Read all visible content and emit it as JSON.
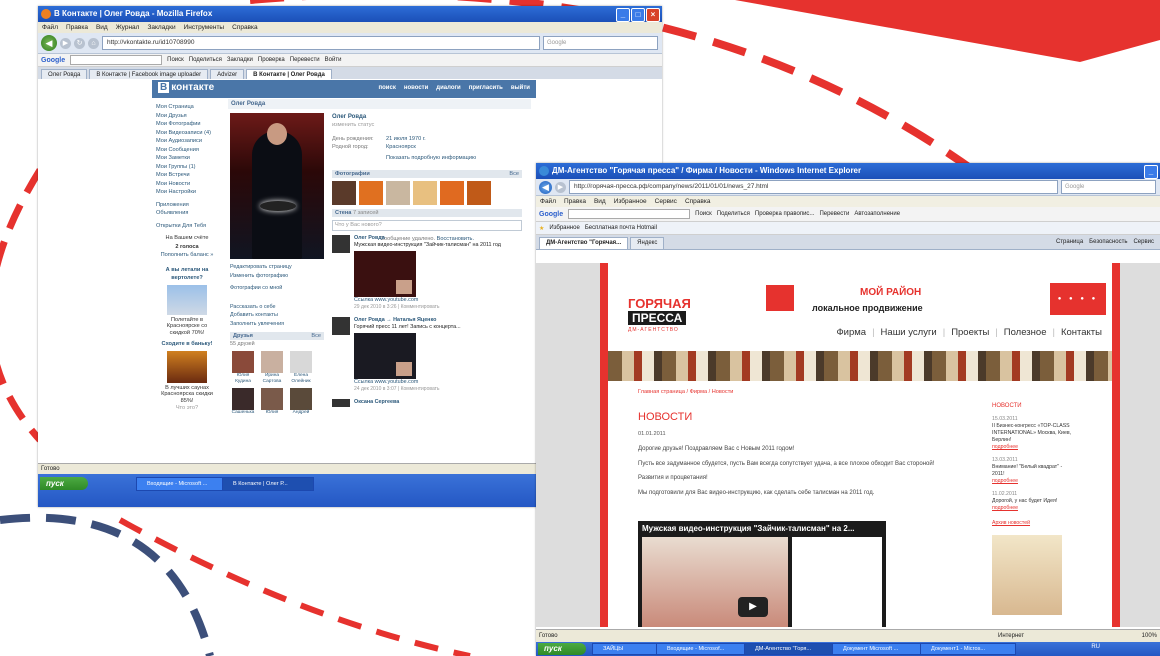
{
  "colors": {
    "accent_red": "#e6322e",
    "dash_blue": "#3c4f7a",
    "vk_blue": "#4a76a8"
  },
  "firefox": {
    "title": "В Контакте | Олег Ровда - Mozilla Firefox",
    "menu": [
      "Файл",
      "Правка",
      "Вид",
      "Журнал",
      "Закладки",
      "Инструменты",
      "Справка"
    ],
    "url": "http://vkontakte.ru/id10708990",
    "search_placeholder": "Google",
    "google_label": "Google",
    "toolbar_items": [
      "Поиск",
      "Поделиться",
      "Закладки",
      "Проверка",
      "Перевести",
      "Войти"
    ],
    "tabs": [
      "Олег Ровда",
      "В Контакте | Facebook image uploader",
      "Advizer",
      "В Контакте | Олег Ровда"
    ],
    "status": "Готово"
  },
  "vk": {
    "logo": "контакте",
    "nav": [
      "поиск",
      "новости",
      "диалоги",
      "пригласить",
      "выйти"
    ],
    "menu": [
      "Моя Страница",
      "Мои Друзья",
      "Мои Фотографии",
      "Мои Видеозаписи (4)",
      "Мои Аудиозаписи",
      "Мои Сообщения",
      "Мои Заметки",
      "Мои Группы (1)",
      "Мои Встречи",
      "Мои Новости",
      "Мои Настройки",
      "Приложения",
      "Объявления",
      "Открытки Для Тебя"
    ],
    "balance_label": "На Вашем счёте",
    "balance_value": "2 голоса",
    "balance_link": "Пополнить баланс »",
    "ad1_title": "А вы летали на вертолете?",
    "ad1_text": "Полетайте в Красноярске со скидкой 70%!",
    "ad2_title": "Сходите в баньку!",
    "ad2_text": "В лучших саунах Красноярска скидки 85%!",
    "ad_more": "Что это?",
    "name_header": "Олег Ровда",
    "profile_name": "Олег Ровда",
    "status_line": "изменить статус",
    "birthday_label": "День рождения:",
    "birthday_value": "21 июля 1970 г.",
    "hometown_label": "Родной город:",
    "hometown_value": "Красноярск",
    "more_info": "Показать подробную информацию",
    "photos_header": "Фотографии",
    "photos_all": "Все",
    "wall_header": "Стена",
    "wall_count": "7 записей",
    "wall_input_placeholder": "Что у Вас нового?",
    "wall_deleted": "Сообщение удалено.",
    "wall_restore": "Восстановить.",
    "edit_page": "Редактировать страницу",
    "change_photo": "Изменить фотографию",
    "photos_with_me": "Фотографии со мной",
    "tell_friends": "Рассказать о себе",
    "add_contacts": "Добавить контакты",
    "fill_interests": "Заполнить увлечения",
    "friends_header": "Друзья",
    "friends_count": "55 друзей",
    "friends_all": "Все",
    "friends": [
      "Юлия Кудина",
      "Ирина Сартова",
      "Елена Олейник",
      "Сашенька",
      "Юлия",
      "Андрей"
    ],
    "posts": [
      {
        "author": "Олег Ровда",
        "text": "Мужская видео-инструкция \"Зайчик-талисман\" на 2011 год",
        "link": "Ссылка www.youtube.com",
        "meta": "29 дек 2010 в 3:26 | Комментировать"
      },
      {
        "author": "Олег Ровда → Наталья Яценко",
        "text": "Горячий пресс 11 лет! Запись с концерта...",
        "link": "Ссылка www.youtube.com",
        "meta": "24 дек 2010 в 3:07 | Комментировать"
      },
      {
        "author": "Оксана Сергеева",
        "text": "",
        "link": "",
        "meta": ""
      }
    ]
  },
  "firefox_taskbar": {
    "start": "пуск",
    "items": [
      "Входящие - Microsoft ...",
      "В Контакте | Олег Р..."
    ]
  },
  "ie": {
    "title": "ДМ-Агентство \"Горячая пресса\" / Фирма / Новости - Windows Internet Explorer",
    "url": "http://горячая-пресса.рф/company/news/2011/01/01/news_27.html",
    "search_placeholder": "Google",
    "menu": [
      "Файл",
      "Правка",
      "Вид",
      "Избранное",
      "Сервис",
      "Справка"
    ],
    "toolbar": [
      "Поиск",
      "Поделиться",
      "Проверка правопис...",
      "Перевести",
      "Автозаполнение"
    ],
    "favorites": [
      "Избранное",
      "Бесплатная почта Hotmail"
    ],
    "tabs": [
      "ДМ-Агентство \"Горячая...",
      "Яндекс"
    ],
    "commandbar": [
      "Страница",
      "Безопасность",
      "Сервис"
    ],
    "status": "Готово",
    "zone": "Интернет",
    "zoom": "100%"
  },
  "site": {
    "logo_line1": "ГОРЯЧАЯ",
    "logo_line2": "ПРЕССА",
    "logo_line3": "ДМ-АГЕНТСТВО",
    "region": "МОЙ РАЙОН",
    "tagline": "локальное продвижение",
    "nav": [
      "Фирма",
      "Наши услуги",
      "Проекты",
      "Полезное",
      "Контакты"
    ],
    "breadcrumb": "Главная страница / Фирма / Новости",
    "news_title": "НОВОСТИ",
    "news_date": "01.01.2011",
    "paragraphs": [
      "Дорогие друзья! Поздравляем Вас с Новым 2011 годом!",
      "Пусть все задуманное сбудется, пусть Вам всегда сопутствует удача, а все плохое обходит Вас стороной!",
      "Развития и процветания!",
      "Мы подготовили для Вас видео-инструкцию, как сделать себе талисман на 2011 год."
    ],
    "video_title": "Мужская видео-инструкция \"Зайчик-талисман\" на 2...",
    "sidebar_title": "НОВОСТИ",
    "side_news": [
      {
        "date": "15.03.2011",
        "text": "II Бизнес-конгресс «TOP-CLASS INTERNATIONAL» Москва, Киев, Берлин!",
        "more": "подробнее"
      },
      {
        "date": "13.03.2011",
        "text": "Внимание! \"Белый квадрат\" - 2011!",
        "more": "подробнее"
      },
      {
        "date": "11.02.2011",
        "text": "Дорогой, у нас будет Идея!",
        "more": "подробнее"
      }
    ],
    "archive": "Архив новостей"
  },
  "ie_taskbar": {
    "start": "пуск",
    "items": [
      "ЗАЙЦЫ",
      "Входящие - Microsof...",
      "ДМ-Агентство \"Горя...",
      "Документ Microsoft ...",
      "Документ1 - Micros..."
    ],
    "lang": "RU"
  }
}
